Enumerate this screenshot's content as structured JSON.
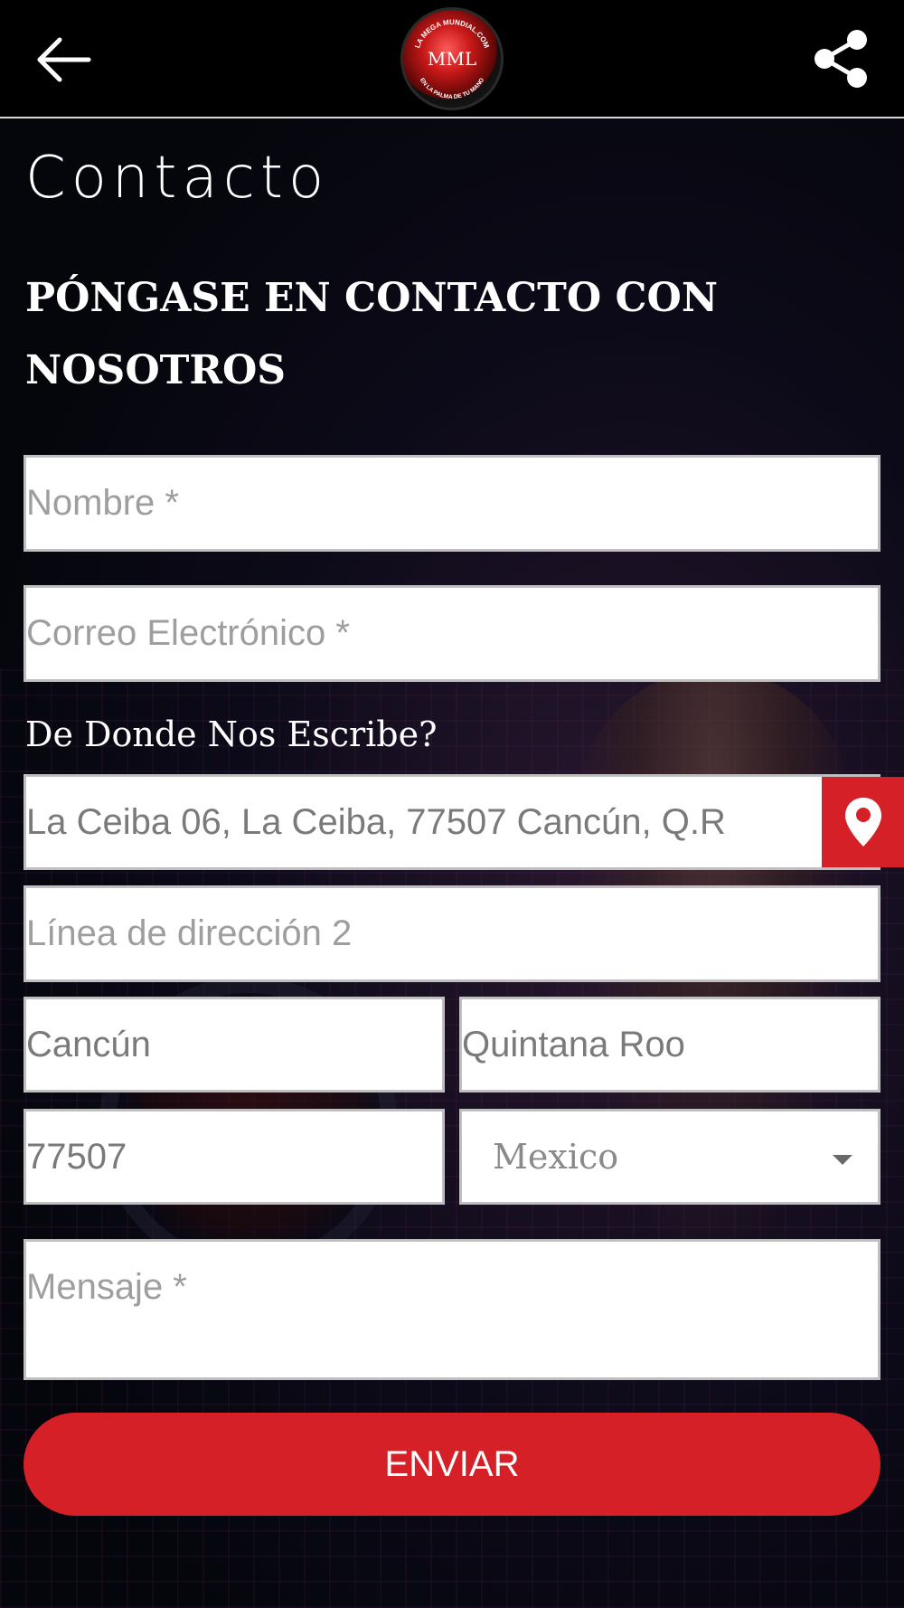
{
  "header": {
    "back_icon": "arrow-left-icon",
    "share_icon": "share-icon",
    "logo_text_top": "LA MEGA MUNDIAL.COM",
    "logo_text_bottom": "EN LA PALMA DE TU MANO",
    "logo_monogram": "MML"
  },
  "page": {
    "title": "Contacto",
    "heading": "PÓNGASE EN CONTACTO CON NOSOTROS"
  },
  "form": {
    "name": {
      "placeholder": "Nombre *",
      "value": ""
    },
    "email": {
      "placeholder": "Correo Electrónico *",
      "value": ""
    },
    "where_label": "De Donde Nos Escribe?",
    "address1": {
      "value": "La Ceiba 06, La Ceiba, 77507 Cancún, Q.R",
      "icon": "map-pin-icon"
    },
    "address2": {
      "placeholder": "Línea de dirección 2",
      "value": ""
    },
    "city": {
      "value": "Cancún"
    },
    "state": {
      "value": "Quintana Roo"
    },
    "zip": {
      "value": "77507"
    },
    "country": {
      "selected": "Mexico"
    },
    "message": {
      "placeholder": "Mensaje *",
      "value": ""
    },
    "submit_label": "ENVIAR"
  },
  "colors": {
    "accent": "#d52027",
    "header_bg": "#000000",
    "field_bg": "#ffffff"
  }
}
